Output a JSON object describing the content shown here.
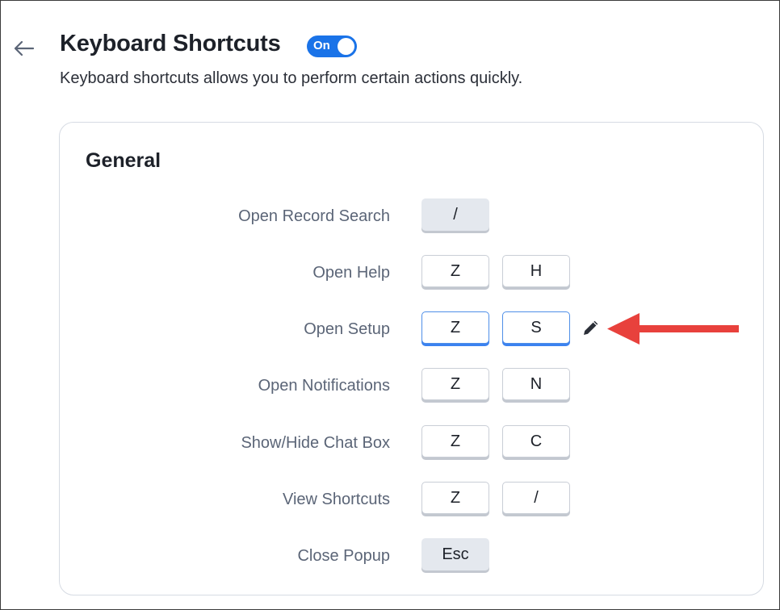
{
  "header": {
    "title": "Keyboard Shortcuts",
    "toggle_label": "On",
    "toggle_state": "on",
    "subtitle": "Keyboard shortcuts allows you to perform certain actions quickly."
  },
  "section": {
    "title": "General",
    "rows": [
      {
        "label": "Open Record Search",
        "keys": [
          "/"
        ]
      },
      {
        "label": "Open Help",
        "keys": [
          "Z",
          "H"
        ]
      },
      {
        "label": "Open Setup",
        "keys": [
          "Z",
          "S"
        ]
      },
      {
        "label": "Open Notifications",
        "keys": [
          "Z",
          "N"
        ]
      },
      {
        "label": "Show/Hide Chat Box",
        "keys": [
          "Z",
          "C"
        ]
      },
      {
        "label": "View Shortcuts",
        "keys": [
          "Z",
          "/"
        ]
      },
      {
        "label": "Close Popup",
        "keys": [
          "Esc"
        ]
      }
    ]
  },
  "icons": {
    "back": "arrow-left-icon",
    "edit": "pencil-icon",
    "annotation": "red-arrow-annotation"
  },
  "colors": {
    "accent": "#1a73e8",
    "annotation": "#e8413c"
  }
}
